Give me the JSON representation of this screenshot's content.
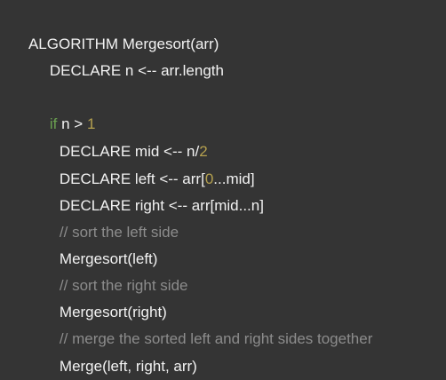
{
  "code": {
    "line1": "ALGORITHM Mergesort(arr)",
    "line2": "DECLARE n <-- arr.length",
    "line4": {
      "kw": "if",
      "rest": " n > ",
      "num": "1"
    },
    "line5": {
      "pre": "DECLARE mid <-- n/",
      "num": "2"
    },
    "line6": {
      "pre": "DECLARE left <-- arr[",
      "num": "0",
      "post": "...mid]"
    },
    "line7": "DECLARE right <-- arr[mid...n]",
    "line8": "// sort the left side",
    "line9": "Mergesort(left)",
    "line10": "// sort the right side",
    "line11": "Mergesort(right)",
    "line12": "// merge the sorted left and right sides together",
    "line13": "Merge(left, right, arr)"
  },
  "colors": {
    "background": "#343434",
    "text": "#f2f2f2",
    "keyword": "#6a9f50",
    "number": "#b5a14f",
    "comment": "#8c8c8c"
  }
}
